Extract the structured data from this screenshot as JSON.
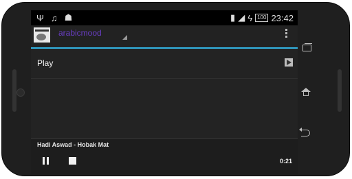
{
  "statusbar": {
    "time": "23:42",
    "battery": "100",
    "icons_left": [
      "usb-icon",
      "music-note-icon",
      "android-icon"
    ],
    "icons_right": [
      "vibrate-icon",
      "signal-icon",
      "charging-icon"
    ]
  },
  "app": {
    "title": "arabicmood",
    "logo_icon": "app-logo-icon",
    "accent": "#33b5e5",
    "title_color": "#6a3ec6"
  },
  "list": {
    "items": [
      {
        "label": "Play",
        "icon": "play-icon"
      }
    ]
  },
  "player": {
    "track": "Hadi Aswad - Hobak Mat",
    "time": "0:21"
  }
}
